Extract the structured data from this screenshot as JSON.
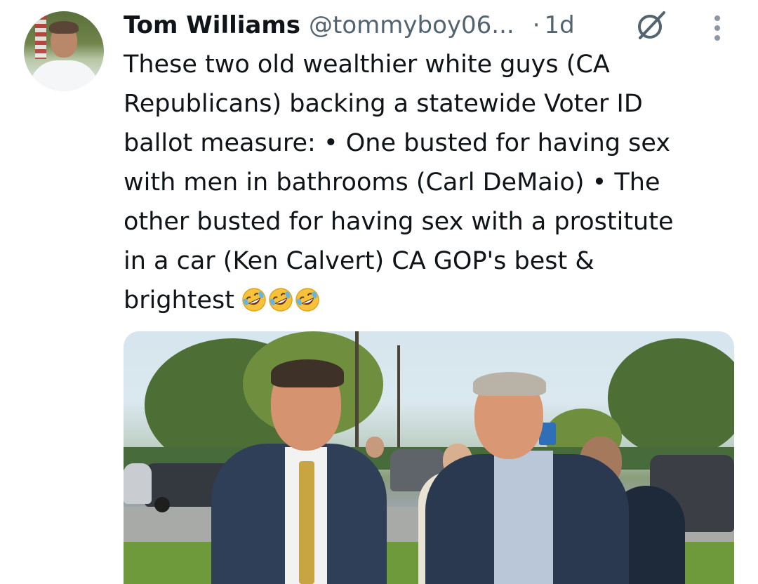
{
  "tweet": {
    "author_name": "Tom Williams",
    "author_handle": "@tommyboy06...",
    "dot": "·",
    "time": "1d",
    "text_lines": [
      "These two old wealthier white guys (CA",
      "Republicans) backing a statewide Voter ID",
      "ballot measure:  • One busted for having sex",
      "with men in bathrooms (Carl DeMaio)  • The",
      "other busted for having sex with a prostitute",
      "in a car (Ken Calvert)   CA GOP's best &",
      "brightest"
    ],
    "emojis": [
      "rolling-on-floor-laughing",
      "rolling-on-floor-laughing",
      "rolling-on-floor-laughing"
    ]
  },
  "icons": {
    "grok": "grok-icon",
    "more": "more-options-icon"
  },
  "colors": {
    "text": "#0f1419",
    "secondary": "#536471",
    "background": "#ffffff"
  }
}
